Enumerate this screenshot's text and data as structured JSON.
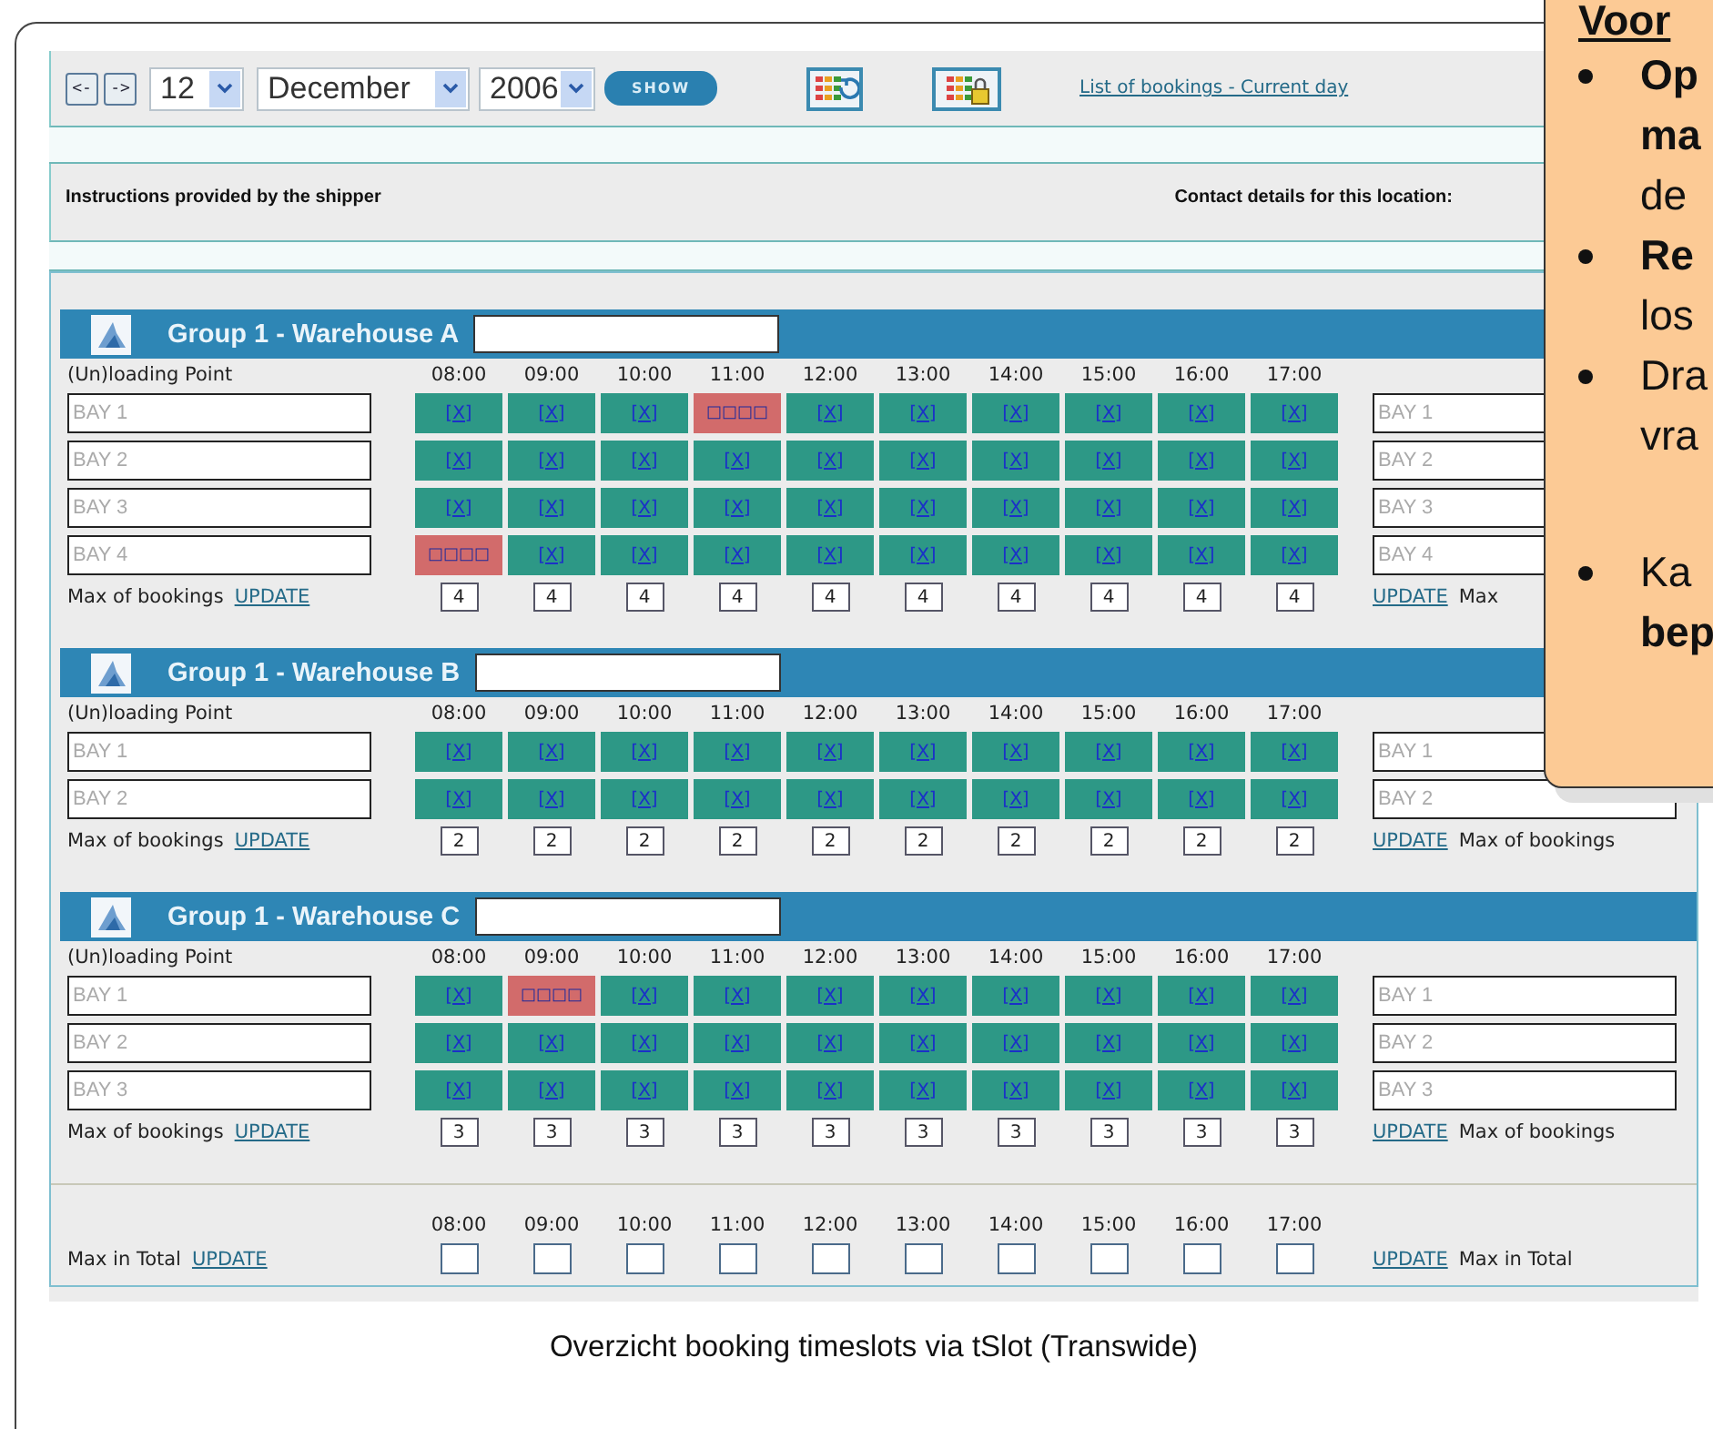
{
  "toolbar": {
    "prev": "<-",
    "next": "->",
    "day": "12",
    "month": "December",
    "year": "2006",
    "show": "SHOW",
    "link": "List of bookings - Current day"
  },
  "info": {
    "instructions": "Instructions provided by the shipper",
    "contact": "Contact details for this location:"
  },
  "groups": [
    {
      "title": "Group 1 - Warehouse A",
      "point_label": "(Un)loading Point",
      "times": [
        "08:00",
        "09:00",
        "10:00",
        "11:00",
        "12:00",
        "13:00",
        "14:00",
        "15:00",
        "16:00",
        "17:00"
      ],
      "bays": [
        {
          "placeholder": "BAY 1",
          "right_placeholder": "BAY 1",
          "slots": [
            {
              "booked": false,
              "label": "[X]"
            },
            {
              "booked": false,
              "label": "[X]"
            },
            {
              "booked": false,
              "label": "[X]"
            },
            {
              "booked": true,
              "label": "□□□□"
            },
            {
              "booked": false,
              "label": "[X]"
            },
            {
              "booked": false,
              "label": "[X]"
            },
            {
              "booked": false,
              "label": "[X]"
            },
            {
              "booked": false,
              "label": "[X]"
            },
            {
              "booked": false,
              "label": "[X]"
            },
            {
              "booked": false,
              "label": "[X]"
            }
          ]
        },
        {
          "placeholder": "BAY 2",
          "right_placeholder": "BAY 2",
          "slots": [
            {
              "booked": false,
              "label": "[X]"
            },
            {
              "booked": false,
              "label": "[X]"
            },
            {
              "booked": false,
              "label": "[X]"
            },
            {
              "booked": false,
              "label": "[X]"
            },
            {
              "booked": false,
              "label": "[X]"
            },
            {
              "booked": false,
              "label": "[X]"
            },
            {
              "booked": false,
              "label": "[X]"
            },
            {
              "booked": false,
              "label": "[X]"
            },
            {
              "booked": false,
              "label": "[X]"
            },
            {
              "booked": false,
              "label": "[X]"
            }
          ]
        },
        {
          "placeholder": "BAY 3",
          "right_placeholder": "BAY 3",
          "slots": [
            {
              "booked": false,
              "label": "[X]"
            },
            {
              "booked": false,
              "label": "[X]"
            },
            {
              "booked": false,
              "label": "[X]"
            },
            {
              "booked": false,
              "label": "[X]"
            },
            {
              "booked": false,
              "label": "[X]"
            },
            {
              "booked": false,
              "label": "[X]"
            },
            {
              "booked": false,
              "label": "[X]"
            },
            {
              "booked": false,
              "label": "[X]"
            },
            {
              "booked": false,
              "label": "[X]"
            },
            {
              "booked": false,
              "label": "[X]"
            }
          ]
        },
        {
          "placeholder": "BAY 4",
          "right_placeholder": "BAY 4",
          "slots": [
            {
              "booked": true,
              "label": "□□□□"
            },
            {
              "booked": false,
              "label": "[X]"
            },
            {
              "booked": false,
              "label": "[X]"
            },
            {
              "booked": false,
              "label": "[X]"
            },
            {
              "booked": false,
              "label": "[X]"
            },
            {
              "booked": false,
              "label": "[X]"
            },
            {
              "booked": false,
              "label": "[X]"
            },
            {
              "booked": false,
              "label": "[X]"
            },
            {
              "booked": false,
              "label": "[X]"
            },
            {
              "booked": false,
              "label": "[X]"
            }
          ]
        }
      ],
      "max_label": "Max of bookings",
      "update": "UPDATE",
      "max_values": [
        "4",
        "4",
        "4",
        "4",
        "4",
        "4",
        "4",
        "4",
        "4",
        "4"
      ],
      "right_update": "UPDATE",
      "right_label": "Max"
    },
    {
      "title": "Group 1 - Warehouse B",
      "point_label": "(Un)loading Point",
      "times": [
        "08:00",
        "09:00",
        "10:00",
        "11:00",
        "12:00",
        "13:00",
        "14:00",
        "15:00",
        "16:00",
        "17:00"
      ],
      "bays": [
        {
          "placeholder": "BAY 1",
          "right_placeholder": "BAY 1",
          "slots": [
            {
              "booked": false,
              "label": "[X]"
            },
            {
              "booked": false,
              "label": "[X]"
            },
            {
              "booked": false,
              "label": "[X]"
            },
            {
              "booked": false,
              "label": "[X]"
            },
            {
              "booked": false,
              "label": "[X]"
            },
            {
              "booked": false,
              "label": "[X]"
            },
            {
              "booked": false,
              "label": "[X]"
            },
            {
              "booked": false,
              "label": "[X]"
            },
            {
              "booked": false,
              "label": "[X]"
            },
            {
              "booked": false,
              "label": "[X]"
            }
          ]
        },
        {
          "placeholder": "BAY 2",
          "right_placeholder": "BAY 2",
          "slots": [
            {
              "booked": false,
              "label": "[X]"
            },
            {
              "booked": false,
              "label": "[X]"
            },
            {
              "booked": false,
              "label": "[X]"
            },
            {
              "booked": false,
              "label": "[X]"
            },
            {
              "booked": false,
              "label": "[X]"
            },
            {
              "booked": false,
              "label": "[X]"
            },
            {
              "booked": false,
              "label": "[X]"
            },
            {
              "booked": false,
              "label": "[X]"
            },
            {
              "booked": false,
              "label": "[X]"
            },
            {
              "booked": false,
              "label": "[X]"
            }
          ]
        }
      ],
      "max_label": "Max of bookings",
      "update": "UPDATE",
      "max_values": [
        "2",
        "2",
        "2",
        "2",
        "2",
        "2",
        "2",
        "2",
        "2",
        "2"
      ],
      "right_update": "UPDATE",
      "right_label": "Max of bookings"
    },
    {
      "title": "Group 1 - Warehouse C",
      "point_label": "(Un)loading Point",
      "times": [
        "08:00",
        "09:00",
        "10:00",
        "11:00",
        "12:00",
        "13:00",
        "14:00",
        "15:00",
        "16:00",
        "17:00"
      ],
      "bays": [
        {
          "placeholder": "BAY 1",
          "right_placeholder": "BAY 1",
          "slots": [
            {
              "booked": false,
              "label": "[X]"
            },
            {
              "booked": true,
              "label": "□□□□"
            },
            {
              "booked": false,
              "label": "[X]"
            },
            {
              "booked": false,
              "label": "[X]"
            },
            {
              "booked": false,
              "label": "[X]"
            },
            {
              "booked": false,
              "label": "[X]"
            },
            {
              "booked": false,
              "label": "[X]"
            },
            {
              "booked": false,
              "label": "[X]"
            },
            {
              "booked": false,
              "label": "[X]"
            },
            {
              "booked": false,
              "label": "[X]"
            }
          ]
        },
        {
          "placeholder": "BAY 2",
          "right_placeholder": "BAY 2",
          "slots": [
            {
              "booked": false,
              "label": "[X]"
            },
            {
              "booked": false,
              "label": "[X]"
            },
            {
              "booked": false,
              "label": "[X]"
            },
            {
              "booked": false,
              "label": "[X]"
            },
            {
              "booked": false,
              "label": "[X]"
            },
            {
              "booked": false,
              "label": "[X]"
            },
            {
              "booked": false,
              "label": "[X]"
            },
            {
              "booked": false,
              "label": "[X]"
            },
            {
              "booked": false,
              "label": "[X]"
            },
            {
              "booked": false,
              "label": "[X]"
            }
          ]
        },
        {
          "placeholder": "BAY 3",
          "right_placeholder": "BAY 3",
          "slots": [
            {
              "booked": false,
              "label": "[X]"
            },
            {
              "booked": false,
              "label": "[X]"
            },
            {
              "booked": false,
              "label": "[X]"
            },
            {
              "booked": false,
              "label": "[X]"
            },
            {
              "booked": false,
              "label": "[X]"
            },
            {
              "booked": false,
              "label": "[X]"
            },
            {
              "booked": false,
              "label": "[X]"
            },
            {
              "booked": false,
              "label": "[X]"
            },
            {
              "booked": false,
              "label": "[X]"
            },
            {
              "booked": false,
              "label": "[X]"
            }
          ]
        }
      ],
      "max_label": "Max of bookings",
      "update": "UPDATE",
      "max_values": [
        "3",
        "3",
        "3",
        "3",
        "3",
        "3",
        "3",
        "3",
        "3",
        "3"
      ],
      "right_update": "UPDATE",
      "right_label": "Max of bookings"
    }
  ],
  "total": {
    "times": [
      "08:00",
      "09:00",
      "10:00",
      "11:00",
      "12:00",
      "13:00",
      "14:00",
      "15:00",
      "16:00",
      "17:00"
    ],
    "label": "Max in Total",
    "update": "UPDATE",
    "right_update": "UPDATE",
    "right_label": "Max in Total"
  },
  "caption": "Overzicht booking timeslots via tSlot (Transwide)",
  "callout": {
    "heading": "Voor",
    "bullets": [
      {
        "lines": [
          {
            "text": "Op",
            "bold": true
          },
          {
            "text": "ma",
            "bold": true
          },
          {
            "text": "de",
            "bold": false
          }
        ]
      },
      {
        "lines": [
          {
            "text": "Re",
            "bold": true
          },
          {
            "text": "los",
            "bold": false
          }
        ]
      },
      {
        "lines": [
          {
            "text": "Dra",
            "bold": false
          },
          {
            "text": "vra",
            "bold": false
          }
        ]
      },
      {
        "lines": [
          {
            "text": "Ka",
            "bold": false
          },
          {
            "text": "bep",
            "bold": true
          }
        ]
      }
    ]
  }
}
